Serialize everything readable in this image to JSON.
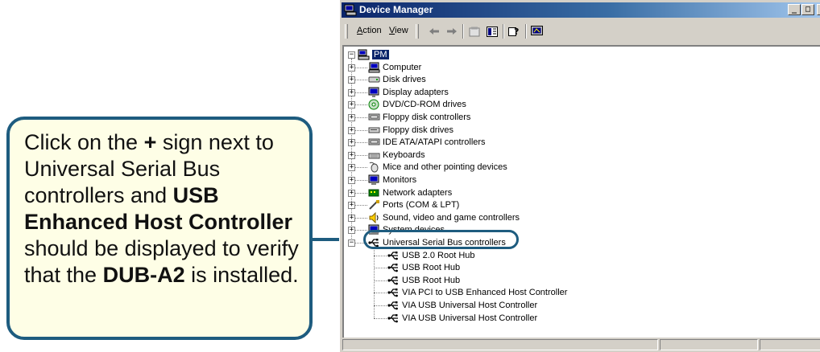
{
  "callout": {
    "segments": [
      {
        "text": "Click on the ",
        "bold": false
      },
      {
        "text": "+",
        "bold": true
      },
      {
        "text": " sign next to Universal Serial Bus controllers and  ",
        "bold": false
      },
      {
        "text": "USB Enhanced Host Controller",
        "bold": true
      },
      {
        "text": " should be displayed to verify that the ",
        "bold": false
      },
      {
        "text": "DUB-A2",
        "bold": true
      },
      {
        "text": " is installed.",
        "bold": false
      }
    ]
  },
  "window": {
    "title": "Device Manager",
    "controls": {
      "minimize": "_",
      "maximize": "□",
      "close": "×"
    },
    "menu": [
      {
        "label": "Action"
      },
      {
        "label": "View"
      }
    ],
    "toolbar_icons": [
      "back-icon",
      "forward-icon",
      "properties-icon",
      "view-icon",
      "help-icon",
      "scan-icon"
    ]
  },
  "tree": {
    "root": "PM",
    "categories": [
      {
        "label": "Computer",
        "icon": "computer-icon",
        "expanded": false
      },
      {
        "label": "Disk drives",
        "icon": "disk-icon",
        "expanded": false
      },
      {
        "label": "Display adapters",
        "icon": "display-icon",
        "expanded": false
      },
      {
        "label": "DVD/CD-ROM drives",
        "icon": "dvd-icon",
        "expanded": false
      },
      {
        "label": "Floppy disk controllers",
        "icon": "controller-icon",
        "expanded": false
      },
      {
        "label": "Floppy disk drives",
        "icon": "floppy-icon",
        "expanded": false
      },
      {
        "label": "IDE ATA/ATAPI controllers",
        "icon": "controller-icon",
        "expanded": false
      },
      {
        "label": "Keyboards",
        "icon": "keyboard-icon",
        "expanded": false
      },
      {
        "label": "Mice and other pointing devices",
        "icon": "mouse-icon",
        "expanded": false
      },
      {
        "label": "Monitors",
        "icon": "monitor-icon",
        "expanded": false
      },
      {
        "label": "Network adapters",
        "icon": "network-icon",
        "expanded": false
      },
      {
        "label": "Ports (COM & LPT)",
        "icon": "port-icon",
        "expanded": false
      },
      {
        "label": "Sound, video and game controllers",
        "icon": "sound-icon",
        "expanded": false
      },
      {
        "label": "System devices",
        "icon": "system-icon",
        "expanded": false
      },
      {
        "label": "Universal Serial Bus controllers",
        "icon": "usb-icon",
        "expanded": true
      }
    ],
    "usb_children": [
      "USB 2.0 Root Hub",
      "USB Root Hub",
      "USB Root Hub",
      "VIA PCI to USB Enhanced Host Controller",
      "VIA USB Universal Host Controller",
      "VIA USB Universal Host Controller"
    ]
  },
  "colors": {
    "callout_border": "#1e5c7f",
    "callout_fill": "#fefee6",
    "titlebar": "#0a246a",
    "chrome": "#d4d0c8"
  }
}
